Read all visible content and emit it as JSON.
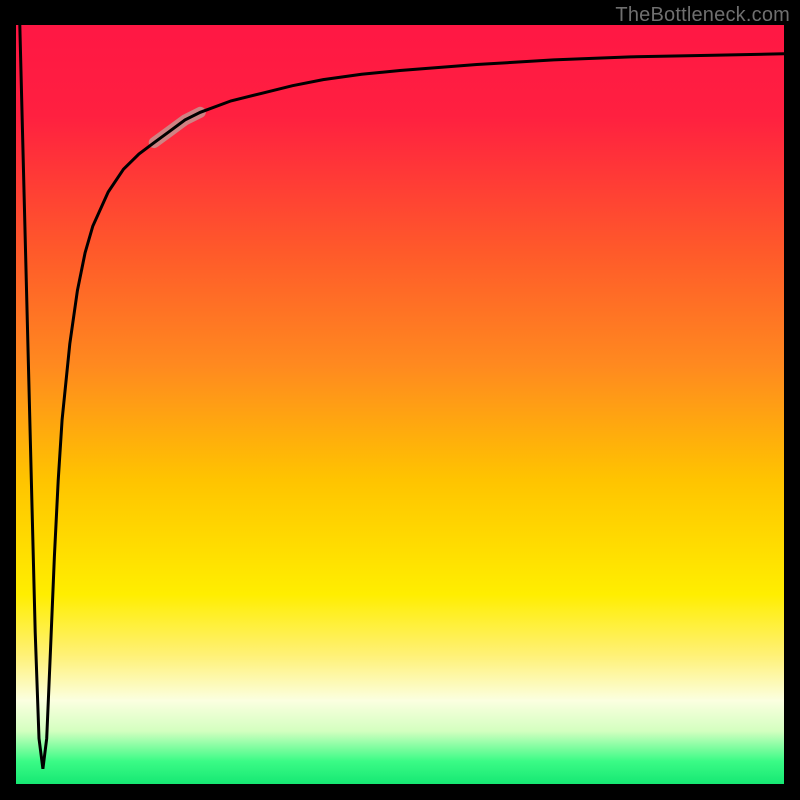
{
  "attribution": "TheBottleneck.com",
  "colors": {
    "frame": "#000000",
    "curve": "#000000",
    "highlight": "#c7938f",
    "gradient_stops": [
      {
        "offset": 0.0,
        "color": "#ff1744"
      },
      {
        "offset": 0.12,
        "color": "#ff2040"
      },
      {
        "offset": 0.3,
        "color": "#ff5a2a"
      },
      {
        "offset": 0.45,
        "color": "#ff8a1f"
      },
      {
        "offset": 0.6,
        "color": "#ffc400"
      },
      {
        "offset": 0.75,
        "color": "#ffee00"
      },
      {
        "offset": 0.83,
        "color": "#fff176"
      },
      {
        "offset": 0.89,
        "color": "#fbffe0"
      },
      {
        "offset": 0.93,
        "color": "#d4ffc0"
      },
      {
        "offset": 0.97,
        "color": "#3bfb86"
      },
      {
        "offset": 1.0,
        "color": "#16e873"
      }
    ]
  },
  "chart_data": {
    "type": "line",
    "title": "",
    "xlabel": "",
    "ylabel": "",
    "xlim": [
      0,
      100
    ],
    "ylim": [
      0,
      100
    ],
    "grid": false,
    "legend": false,
    "annotations": [
      "TheBottleneck.com"
    ],
    "series": [
      {
        "name": "curve",
        "x": [
          0.5,
          1.5,
          2.5,
          3.0,
          3.5,
          4.0,
          4.5,
          5.0,
          5.5,
          6.0,
          7.0,
          8.0,
          9.0,
          10.0,
          12.0,
          14.0,
          16.0,
          18.0,
          20.0,
          22.0,
          24.0,
          28.0,
          32.0,
          36.0,
          40.0,
          45.0,
          50.0,
          55.0,
          60.0,
          70.0,
          80.0,
          90.0,
          100.0
        ],
        "y": [
          100.0,
          60.0,
          20.0,
          6.0,
          2.0,
          6.0,
          18.0,
          30.0,
          40.0,
          48.0,
          58.0,
          65.0,
          70.0,
          73.5,
          78.0,
          81.0,
          83.0,
          84.5,
          86.0,
          87.5,
          88.5,
          90.0,
          91.0,
          92.0,
          92.8,
          93.5,
          94.0,
          94.4,
          94.8,
          95.4,
          95.8,
          96.0,
          96.2
        ]
      }
    ],
    "highlight_segment": {
      "series": "curve",
      "x_range": [
        18,
        24
      ],
      "style": "thick-muted"
    },
    "background_gradient": "vertical red→orange→yellow→pale→green"
  }
}
